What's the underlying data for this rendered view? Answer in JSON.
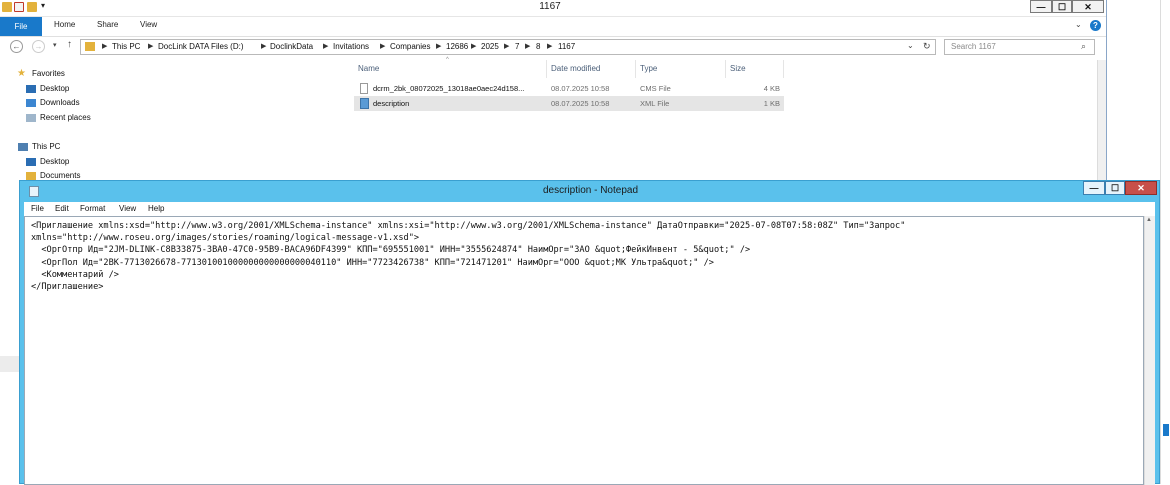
{
  "explorer": {
    "title": "1167",
    "ribbon_tabs": [
      "File",
      "Home",
      "Share",
      "View"
    ],
    "breadcrumb": [
      "This PC",
      "DocLink DATA Files (D:)",
      "DoclinkData",
      "Invitations",
      "Companies",
      "12686",
      "2025",
      "7",
      "8",
      "1167"
    ],
    "search_placeholder": "Search 1167",
    "nav": {
      "favorites": "Favorites",
      "desktop": "Desktop",
      "downloads": "Downloads",
      "recent": "Recent places",
      "this_pc": "This PC",
      "pc_desktop": "Desktop",
      "documents": "Documents"
    },
    "columns": [
      "Name",
      "Date modified",
      "Type",
      "Size"
    ],
    "files": [
      {
        "name": "dcrm_2bk_08072025_13018ae0aec24d158...",
        "date": "08.07.2025 10:58",
        "type": "CMS File",
        "size": "4 KB"
      },
      {
        "name": "description",
        "date": "08.07.2025 10:58",
        "type": "XML File",
        "size": "1 KB"
      }
    ]
  },
  "notepad": {
    "title": "description - Notepad",
    "menu": [
      "File",
      "Edit",
      "Format",
      "View",
      "Help"
    ],
    "content": "<Приглашение xmlns:xsd=\"http://www.w3.org/2001/XMLSchema-instance\" xmlns:xsi=\"http://www.w3.org/2001/XMLSchema-instance\" ДатаОтправки=\"2025-07-08T07:58:08Z\" Тип=\"Запрос\"\nxmlns=\"http://www.roseu.org/images/stories/roaming/logical-message-v1.xsd\">\n  <ОргОтпр Ид=\"2JM-DLINK-C8B33875-3BA0-47C0-95B9-BACA96DF4399\" КПП=\"695551001\" ИНН=\"3555624874\" НаимОрг=\"ЗАО &quot;ФейкИнвент - 5&quot;\" />\n  <ОргПол Ид=\"2BK-7713026678-771301001000000000000000040110\" ИНН=\"7723426738\" КПП=\"721471201\" НаимОрг=\"ООО &quot;МК Ультра&quot;\" />\n  <Комментарий />\n</Приглашение>"
  },
  "window_buttons": {
    "minimize": "—",
    "maximize": "☐",
    "close": "✕"
  },
  "colors": {
    "file_tab": "#1979ca",
    "notepad_frame": "#5ac1ec",
    "close_button": "#c7504a"
  }
}
